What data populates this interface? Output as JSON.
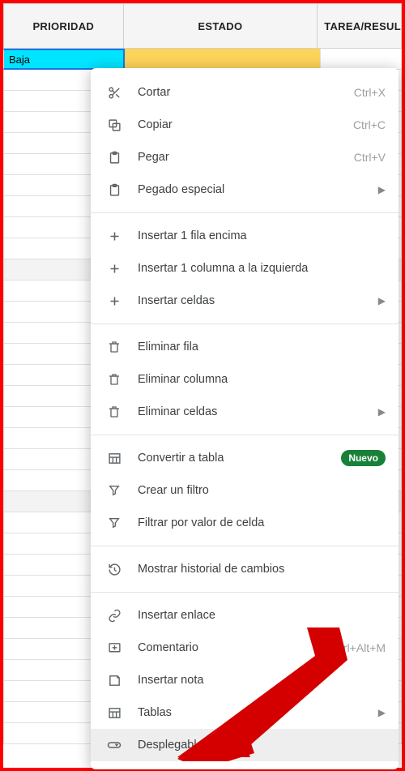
{
  "columns": {
    "c1": "PRIORIDAD",
    "c2": "ESTADO",
    "c3": "TAREA/RESUL"
  },
  "selected_value": "Baja",
  "menu": {
    "cut": "Cortar",
    "cut_k": "Ctrl+X",
    "copy": "Copiar",
    "copy_k": "Ctrl+C",
    "paste": "Pegar",
    "paste_k": "Ctrl+V",
    "pspecial": "Pegado especial",
    "ins_row": "Insertar 1 fila encima",
    "ins_col": "Insertar 1 columna a la izquierda",
    "ins_cells": "Insertar celdas",
    "del_row": "Eliminar fila",
    "del_col": "Eliminar columna",
    "del_cells": "Eliminar celdas",
    "conv_table": "Convertir a tabla",
    "conv_badge": "Nuevo",
    "filter": "Crear un filtro",
    "filter_val": "Filtrar por valor de celda",
    "history": "Mostrar historial de cambios",
    "link": "Insertar enlace",
    "comment": "Comentario",
    "comment_k": "Ctrl+Alt+M",
    "note": "Insertar nota",
    "tables": "Tablas",
    "dropdown": "Desplegable"
  }
}
